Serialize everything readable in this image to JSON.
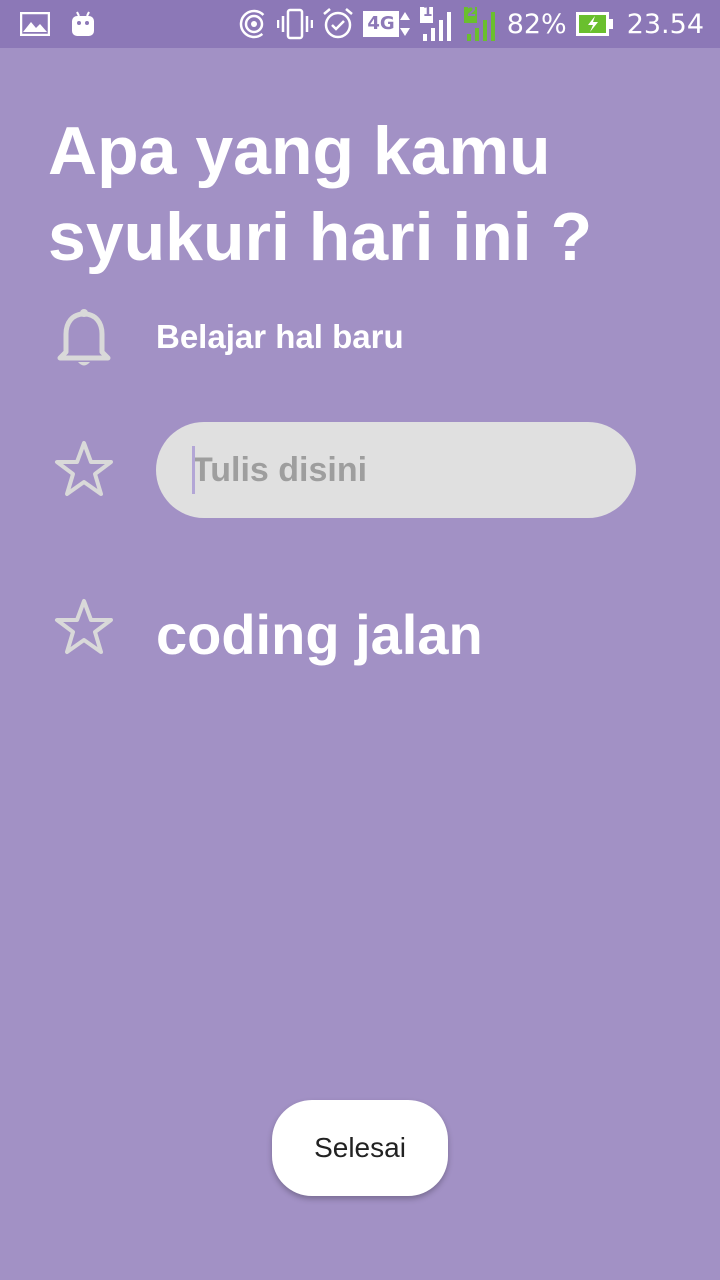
{
  "status_bar": {
    "left_icons": [
      "gallery-icon",
      "android-icon"
    ],
    "right_icons": [
      "hotspot-icon",
      "vibrate-icon",
      "alarm-icon",
      "network-4g-icon",
      "signal-sim1-icon",
      "signal-sim2-icon",
      "battery-charging-icon"
    ],
    "network_label": "4G",
    "sim1_label": "1",
    "sim2_label": "2",
    "battery_percent": "82%",
    "time": "23.54"
  },
  "page": {
    "title": "Apa yang kamu syukuri hari ini ?"
  },
  "items": [
    {
      "icon": "bell-icon",
      "label": "Belajar hal baru"
    },
    {
      "icon": "star-outline-icon",
      "input_value": "",
      "input_placeholder": "Tulis disini"
    },
    {
      "icon": "star-outline-icon",
      "label": "coding jalan"
    }
  ],
  "actions": {
    "done_label": "Selesai"
  },
  "colors": {
    "background": "#a291c5",
    "status_bar": "#8c78b7",
    "input_bg": "#e0e0e0",
    "icon_gray": "#d9d9d9",
    "signal_green": "#6abf2e"
  }
}
